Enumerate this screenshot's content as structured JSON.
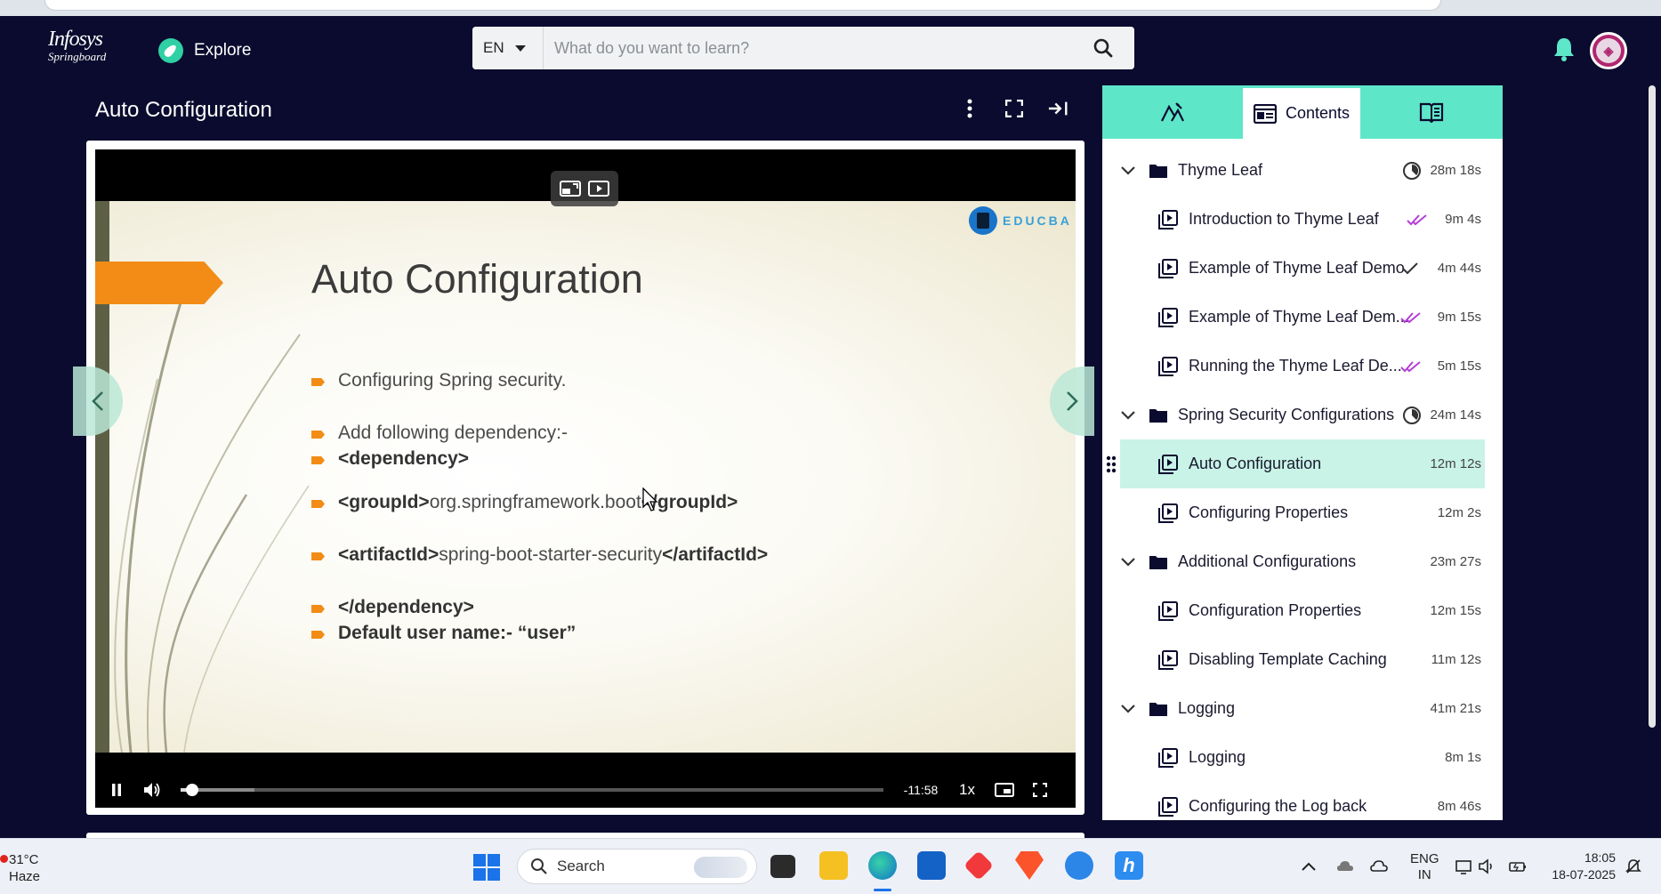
{
  "nav": {
    "logo_line1": "Infosys",
    "logo_line2": "Springboard",
    "explore_label": "Explore",
    "language": "EN",
    "search_placeholder": "What do you want to learn?"
  },
  "lesson": {
    "title": "Auto Configuration"
  },
  "slide": {
    "brand": "EDUCBA",
    "title": "Auto Configuration",
    "bullets": [
      {
        "pre": "",
        "bold": "",
        "text": "Configuring Spring security.",
        "post": ""
      },
      {
        "pre": "",
        "bold": "",
        "text": "Add following dependency:-",
        "post": ""
      },
      {
        "pre": "",
        "bold": "<dependency>",
        "text": "",
        "post": ""
      },
      {
        "pre": "",
        "bold": "<groupId>",
        "text": "org.springframework.boot",
        "post": "</groupId>"
      },
      {
        "pre": "",
        "bold": "<artifactId>",
        "text": "spring-boot-starter-security",
        "post": "</artifactId>"
      },
      {
        "pre": "",
        "bold": "</dependency>",
        "text": "",
        "post": ""
      },
      {
        "pre": "",
        "bold": "Default user name:- “user”",
        "text": "",
        "post": ""
      }
    ]
  },
  "player": {
    "time_remaining": "-11:58",
    "speed": "1x",
    "progress_fraction": 0.01,
    "buffered_fraction": 0.105
  },
  "sidebar": {
    "tabs": [
      {
        "label": "",
        "icon": "notes-icon"
      },
      {
        "label": "Contents",
        "icon": "contents-icon"
      },
      {
        "label": "",
        "icon": "book-icon"
      }
    ],
    "rows": [
      {
        "type": "section",
        "name": "Thyme Leaf",
        "duration": "28m 18s",
        "progress": "partial"
      },
      {
        "type": "item",
        "name": "Introduction to Thyme Leaf",
        "duration": "9m 4s",
        "status": "completed"
      },
      {
        "type": "item",
        "name": "Example of Thyme Leaf Demo",
        "duration": "4m 44s",
        "status": "viewed"
      },
      {
        "type": "item",
        "name": "Example of Thyme Leaf Dem...",
        "duration": "9m 15s",
        "status": "completed"
      },
      {
        "type": "item",
        "name": "Running the Thyme Leaf De...",
        "duration": "5m 15s",
        "status": "completed"
      },
      {
        "type": "section",
        "name": "Spring Security Configurations",
        "duration": "24m 14s",
        "progress": "partial"
      },
      {
        "type": "item",
        "name": "Auto Configuration",
        "duration": "12m 12s",
        "status": "current"
      },
      {
        "type": "item",
        "name": "Configuring Properties",
        "duration": "12m 2s",
        "status": "none"
      },
      {
        "type": "section",
        "name": "Additional Configurations",
        "duration": "23m 27s",
        "progress": "none"
      },
      {
        "type": "item",
        "name": "Configuration Properties",
        "duration": "12m 15s",
        "status": "none"
      },
      {
        "type": "item",
        "name": "Disabling Template Caching",
        "duration": "11m 12s",
        "status": "none"
      },
      {
        "type": "section",
        "name": "Logging",
        "duration": "41m 21s",
        "progress": "none"
      },
      {
        "type": "item",
        "name": "Logging",
        "duration": "8m 1s",
        "status": "none"
      },
      {
        "type": "item",
        "name": "Configuring the Log back",
        "duration": "8m 46s",
        "status": "none"
      }
    ]
  },
  "taskbar": {
    "temperature": "31°C",
    "weather": "Haze",
    "search_label": "Search",
    "lang_line1": "ENG",
    "lang_line2": "IN",
    "time": "18:05",
    "date": "18-07-2025"
  },
  "colors": {
    "nav_bg": "#0a0b2e",
    "accent": "#5ee6c8",
    "highlight": "#c8f3e6",
    "check_completed": "#b43fd6",
    "slide_arrow": "#f28c16"
  }
}
